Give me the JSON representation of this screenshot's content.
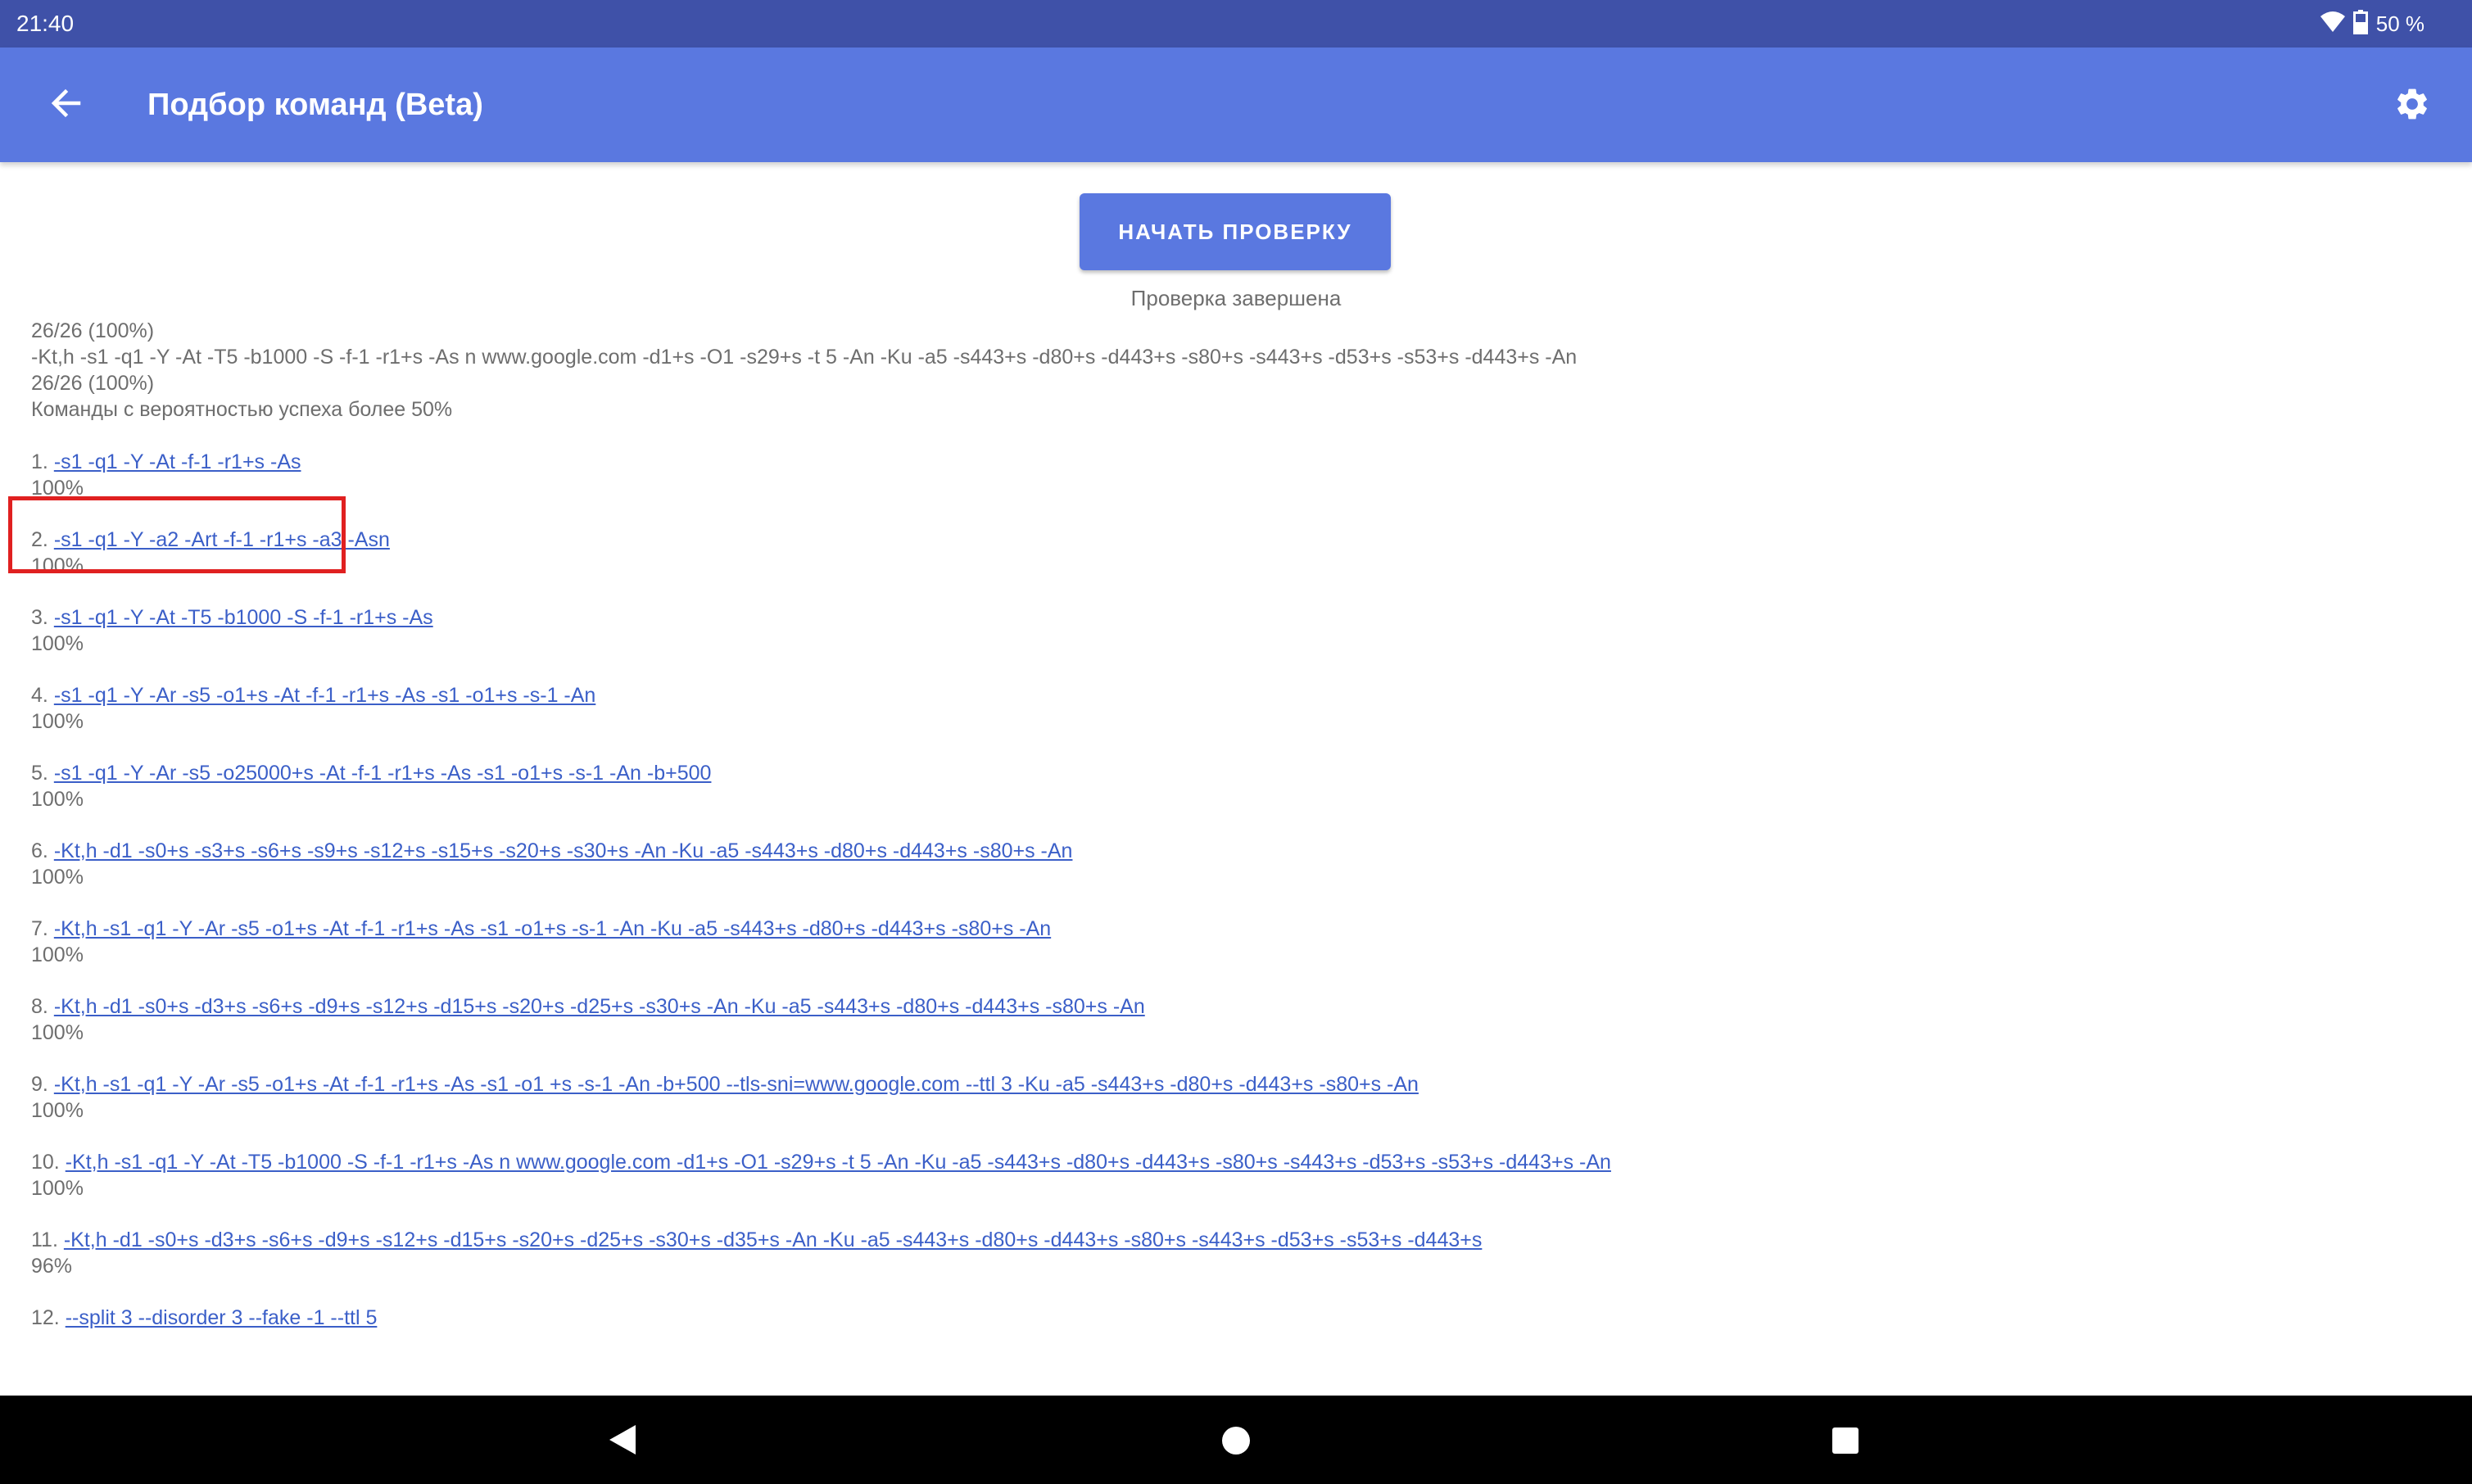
{
  "status_bar": {
    "time": "21:40",
    "battery": "50 %",
    "icons": [
      "wifi-icon",
      "battery-icon"
    ]
  },
  "app_bar": {
    "title": "Подбор команд (Beta)",
    "icons": [
      "back-arrow-icon",
      "gear-icon"
    ]
  },
  "start_button_label": "НАЧАТЬ ПРОВЕРКУ",
  "status_text": "Проверка завершена",
  "progress": "26/26 (100%)",
  "summary": {
    "command": "-Kt,h -s1 -q1 -Y -At -T5 -b1000 -S -f-1 -r1+s -As n www.google.com -d1+s -O1 -s29+s -t 5 -An -Ku -a5 -s443+s -d80+s -d443+s -s80+s -s443+s -d53+s -s53+s -d443+s -An",
    "progress": "26/26 (100%)"
  },
  "subtitle": "Команды с вероятностью успеха более 50%",
  "commands": [
    {
      "num": "1.",
      "cmd": "-s1 -q1 -Y -At -f-1 -r1+s -As",
      "pct": "100%"
    },
    {
      "num": "2.",
      "cmd": "-s1 -q1 -Y -a2 -Art -f-1 -r1+s -a3 -Asn",
      "pct": "100%"
    },
    {
      "num": "3.",
      "cmd": "-s1 -q1 -Y -At -T5 -b1000 -S -f-1 -r1+s -As",
      "pct": "100%"
    },
    {
      "num": "4.",
      "cmd": "-s1 -q1 -Y -Ar -s5 -o1+s -At -f-1 -r1+s -As -s1 -o1+s -s-1 -An",
      "pct": "100%"
    },
    {
      "num": "5.",
      "cmd": "-s1 -q1 -Y -Ar -s5 -o25000+s -At -f-1 -r1+s -As -s1 -o1+s -s-1 -An -b+500",
      "pct": "100%"
    },
    {
      "num": "6.",
      "cmd": "-Kt,h -d1 -s0+s -s3+s -s6+s -s9+s -s12+s -s15+s -s20+s -s30+s -An -Ku -a5 -s443+s -d80+s -d443+s -s80+s -An",
      "pct": "100%"
    },
    {
      "num": "7.",
      "cmd": "-Kt,h -s1 -q1 -Y -Ar -s5 -o1+s -At -f-1 -r1+s -As -s1 -o1+s -s-1 -An -Ku -a5 -s443+s -d80+s -d443+s -s80+s -An",
      "pct": "100%"
    },
    {
      "num": "8.",
      "cmd": "-Kt,h -d1 -s0+s -d3+s -s6+s -d9+s -s12+s -d15+s -s20+s -d25+s -s30+s -An -Ku -a5 -s443+s -d80+s -d443+s -s80+s -An",
      "pct": "100%"
    },
    {
      "num": "9.",
      "cmd": "-Kt,h -s1 -q1 -Y -Ar -s5 -o1+s -At -f-1 -r1+s -As -s1 -o1 +s -s-1 -An -b+500 --tls-sni=www.google.com --ttl 3 -Ku -a5 -s443+s -d80+s -d443+s -s80+s -An",
      "pct": "100%"
    },
    {
      "num": "10.",
      "cmd": "-Kt,h -s1 -q1 -Y -At -T5 -b1000 -S -f-1 -r1+s -As n www.google.com -d1+s -O1 -s29+s -t 5 -An -Ku -a5 -s443+s -d80+s -d443+s -s80+s -s443+s -d53+s -s53+s -d443+s -An",
      "pct": "100%"
    },
    {
      "num": "11.",
      "cmd": "-Kt,h -d1 -s0+s -d3+s -s6+s -d9+s -s12+s -d15+s -s20+s -d25+s -s30+s -d35+s -An -Ku -a5 -s443+s -d80+s -d443+s -s80+s -s443+s -d53+s -s53+s -d443+s",
      "pct": "96%"
    },
    {
      "num": "12.",
      "cmd": "--split 3 --disorder 3 --fake -1 --ttl 5",
      "pct": ""
    }
  ],
  "nav_bar": {
    "icons": [
      "nav-back-icon",
      "nav-home-icon",
      "nav-recents-icon"
    ]
  },
  "colors": {
    "status_bar": "#3f51a8",
    "app_bar": "#5a78e0",
    "link": "#3b5fc8",
    "highlight": "#e02020",
    "text": "#6e6e6e"
  }
}
